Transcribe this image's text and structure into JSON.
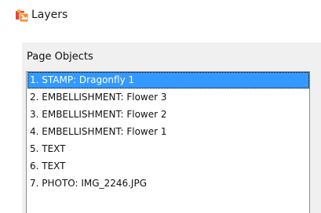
{
  "window": {
    "title": "Layers",
    "icon": "layers-app-icon"
  },
  "page_objects": {
    "label": "Page Objects",
    "items": [
      {
        "label": "1. STAMP: Dragonfly 1",
        "selected": true
      },
      {
        "label": "2. EMBELLISHMENT: Flower 3",
        "selected": false
      },
      {
        "label": "3. EMBELLISHMENT: Flower 2",
        "selected": false
      },
      {
        "label": "4. EMBELLISHMENT: Flower 1",
        "selected": false
      },
      {
        "label": "5. TEXT",
        "selected": false
      },
      {
        "label": "6. TEXT",
        "selected": false
      },
      {
        "label": "7. PHOTO: IMG_2246.JPG",
        "selected": false
      }
    ],
    "selection_color": "#3399ff"
  }
}
